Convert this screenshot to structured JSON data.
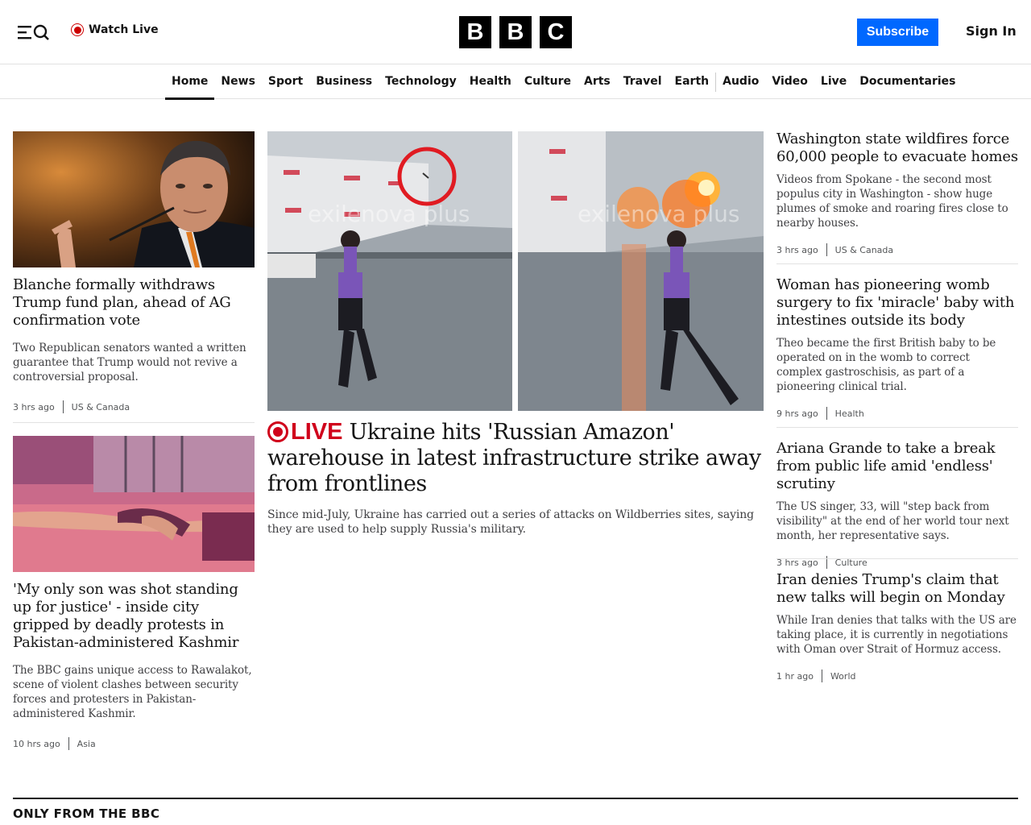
{
  "header": {
    "watch_live": "Watch Live",
    "logo_letters": [
      "B",
      "B",
      "C"
    ],
    "subscribe": "Subscribe",
    "sign_in": "Sign In"
  },
  "nav": {
    "items": [
      "Home",
      "News",
      "Sport",
      "Business",
      "Technology",
      "Health",
      "Culture",
      "Arts",
      "Travel",
      "Earth",
      "Audio",
      "Video",
      "Live",
      "Documentaries"
    ],
    "active": "Home"
  },
  "left_stories": [
    {
      "headline": "Blanche formally withdraws Trump fund plan, ahead of AG confirmation vote",
      "summary": "Two Republican senators wanted a written guarantee that Trump would not revive a controversial proposal.",
      "time": "3 hrs ago",
      "topic": "US & Canada"
    },
    {
      "headline": "'My only son was shot standing up for justice' - inside city gripped by deadly protests in Pakistan-administered Kashmir",
      "summary": "The BBC gains unique access to Rawalakot, scene of violent clashes between security forces and protesters in Pakistan-administered Kashmir.",
      "time": "10 hrs ago",
      "topic": "Asia"
    }
  ],
  "hero": {
    "live_label": "LIVE",
    "headline": "Ukraine hits 'Russian Amazon' warehouse in latest infrastructure strike away from frontlines",
    "summary": "Since mid-July, Ukraine has carried out a series of attacks on Wildberries sites, saying they are used to help supply Russia's military.",
    "watermark": "exilenova plus"
  },
  "right_stories": [
    {
      "headline": "Washington state wildfires force 60,000 people to evacuate homes",
      "summary": "Videos from Spokane - the second most populus city in Washington - show huge plumes of smoke and roaring fires close to nearby houses.",
      "time": "3 hrs ago",
      "topic": "US & Canada"
    },
    {
      "headline": "Woman has pioneering womb surgery to fix 'miracle' baby with intestines outside its body",
      "summary": "Theo became the first British baby to be operated on in the womb to correct complex gastroschisis, as part of a pioneering clinical trial.",
      "time": "9 hrs ago",
      "topic": "Health"
    },
    {
      "headline": "Ariana Grande to take a break from public life amid 'endless' scrutiny",
      "summary": "The US singer, 33, will \"step back from visibility\" at the end of her world tour next month, her representative says.",
      "time": "3 hrs ago",
      "topic": "Culture"
    },
    {
      "headline": "Iran denies Trump's claim that new talks will begin on Monday",
      "summary": "While Iran denies that talks with the US are taking place, it is currently in negotiations with Oman over Strait of Hormuz access.",
      "time": "1 hr ago",
      "topic": "World"
    }
  ],
  "section": {
    "title": "ONLY FROM THE BBC"
  },
  "colors": {
    "accent_blue": "#0068ff",
    "live_red": "#d0021b"
  }
}
